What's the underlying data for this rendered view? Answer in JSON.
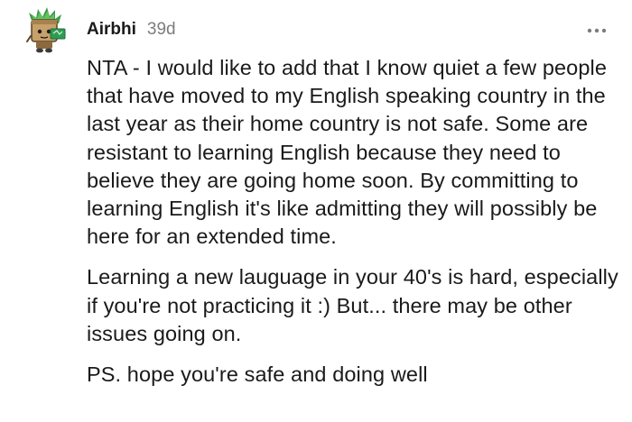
{
  "comment": {
    "author": "Airbhi",
    "age": "39d",
    "more_icon": "more-horizontal-icon",
    "avatar_icon": "snoo-avatar-icon",
    "paragraphs": [
      "NTA - I would like to add that I know quiet a few people that have moved to my English speaking country in the last year as their home country is not safe. Some are resistant to learning English because they need to believe they are going home soon. By committing to learning English it's like admitting they will possibly be here for an extended time.",
      "Learning a new lauguage in your 40's is hard, especially if you're not practicing it :) But... there may be other issues going on.",
      "PS. hope you're safe and doing well"
    ]
  },
  "colors": {
    "text": "#1a1a1b",
    "muted": "#7c7c7c",
    "background": "#ffffff"
  }
}
